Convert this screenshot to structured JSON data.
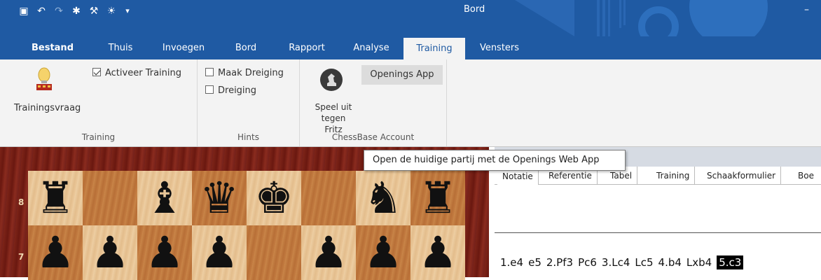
{
  "window": {
    "title": "Bord"
  },
  "quick_access": [
    "save-icon",
    "undo-icon",
    "redo-icon",
    "bug-icon",
    "wrench-icon",
    "lightbulb-icon",
    "customize-icon"
  ],
  "tabs": [
    {
      "label": "Bestand"
    },
    {
      "label": "Thuis"
    },
    {
      "label": "Invoegen"
    },
    {
      "label": "Bord"
    },
    {
      "label": "Rapport"
    },
    {
      "label": "Analyse"
    },
    {
      "label": "Training",
      "active": true
    },
    {
      "label": "Vensters"
    }
  ],
  "ribbon": {
    "training": {
      "trainingsvraag": "Trainingsvraag",
      "activeer": "Activeer Training",
      "activeer_checked": true,
      "label": "Training"
    },
    "hints": {
      "maak": "Maak Dreiging",
      "dreiging": "Dreiging",
      "label": "Hints"
    },
    "account": {
      "speel": "Speel uit",
      "tegen": "tegen Fritz",
      "openings": "Openings App",
      "label": "ChessBase Account"
    }
  },
  "tooltip": "Open de huidige partij met de Openings Web App",
  "board": {
    "ranks": [
      "8",
      "7"
    ],
    "rank8": [
      "♜",
      "",
      "♝",
      "♛",
      "♚",
      "",
      "♞",
      "♜"
    ],
    "rank7": [
      "♟",
      "♟",
      "♟",
      "♟",
      "",
      "♟",
      "♟",
      "♟"
    ]
  },
  "notation": {
    "tabs": [
      "Notatie",
      "Referentie",
      "Tabel",
      "Training",
      "Schaakformulier",
      "Boe"
    ],
    "moves": [
      "1.e4",
      "e5",
      "2.Pf3",
      "Pc6",
      "3.Lc4",
      "Lc5",
      "4.b4",
      "Lxb4",
      "5.c3"
    ],
    "current_move": "5.c3"
  },
  "colors": {
    "accent": "#1f5aa3",
    "ribbon": "#f3f3f3"
  }
}
